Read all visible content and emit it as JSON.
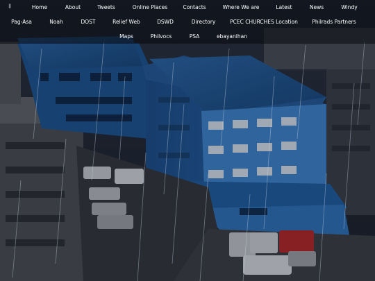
{
  "nav": {
    "pause_glyph": "II",
    "row1": [
      "Home",
      "About",
      "Tweets",
      "Online Places",
      "Contacts",
      "Where We are",
      "Latest",
      "News",
      "Windy"
    ],
    "row2": [
      "Pag-Asa",
      "Noah",
      "DOST",
      "Relief Web",
      "DSWD",
      "Directory",
      "PCEC CHURCHES Location",
      "Philrads Partners"
    ],
    "row3": [
      "Maps",
      "Philvocs",
      "PSA",
      "ebayanihan"
    ]
  },
  "colors": {
    "nav_text": "#ffffff",
    "building_blue": "#1f5fa3",
    "rain": "#c9d4e2"
  },
  "background": {
    "scene": "aerial photo of blue building in the rain",
    "icon": "rainy-building-photo"
  }
}
